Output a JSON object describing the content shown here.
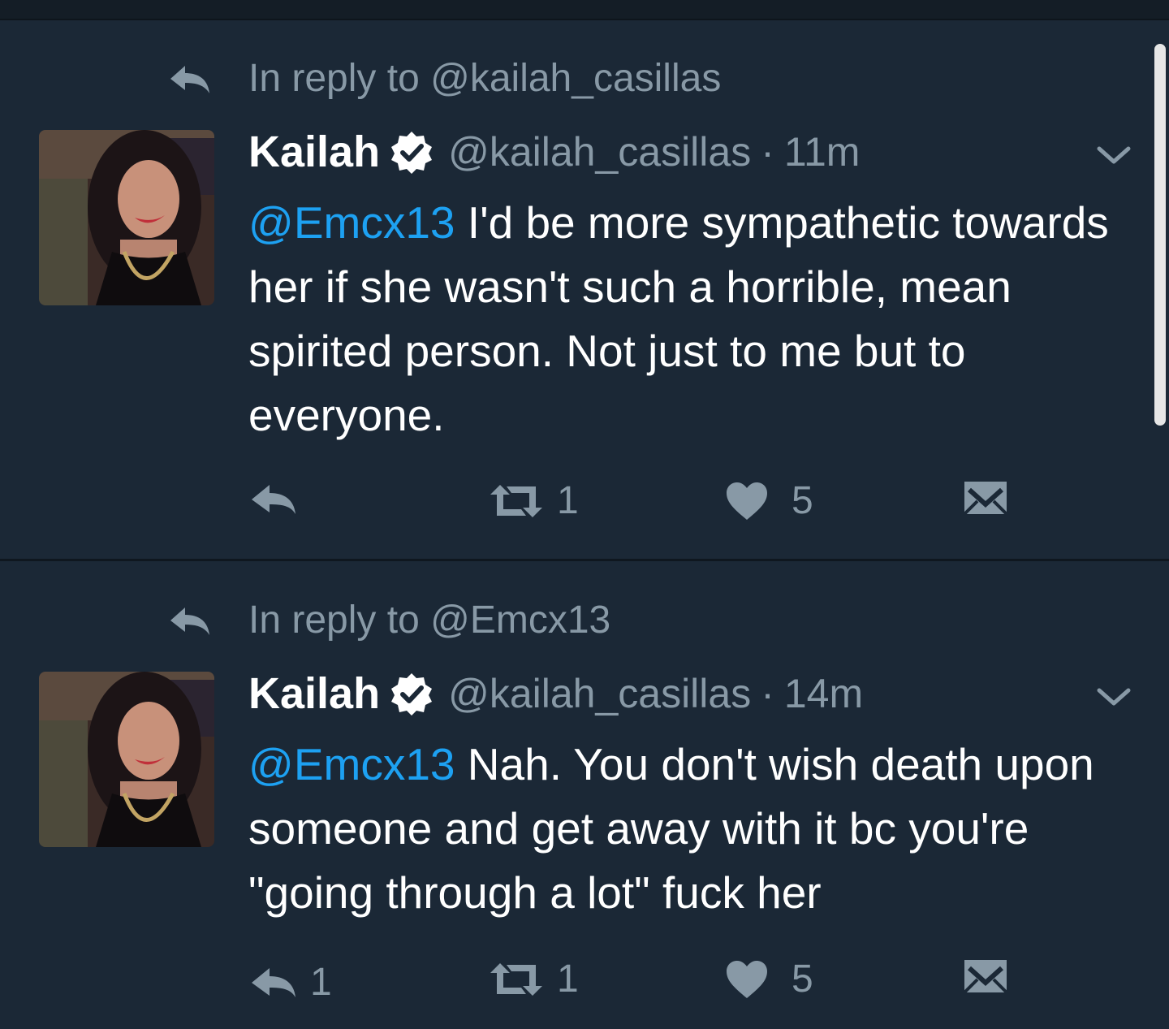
{
  "colors": {
    "background": "#1b2836",
    "text": "#ffffff",
    "secondary": "#8899a6",
    "mention": "#1da1f2"
  },
  "tweets": [
    {
      "context": "In reply to @kailah_casillas",
      "name": "Kailah",
      "handle": "@kailah_casillas",
      "separator": "·",
      "time": "11m",
      "mention": "@Emcx13",
      "text": "I'd be more sympathetic towards her if she wasn't such a horrible, mean spirited person. Not just to me but to everyone.",
      "reply_count": "",
      "retweet_count": "1",
      "like_count": "5"
    },
    {
      "context": "In reply to @Emcx13",
      "name": "Kailah",
      "handle": "@kailah_casillas",
      "separator": "·",
      "time": "14m",
      "mention": "@Emcx13",
      "text": "Nah. You don't wish death upon someone and get away with it bc you're \"going through a lot\" fuck her",
      "reply_count": "1",
      "retweet_count": "1",
      "like_count": "5"
    }
  ],
  "icons": [
    "reply-icon",
    "verified-icon",
    "chevron-down-icon",
    "retweet-icon",
    "heart-icon",
    "direct-message-icon"
  ]
}
